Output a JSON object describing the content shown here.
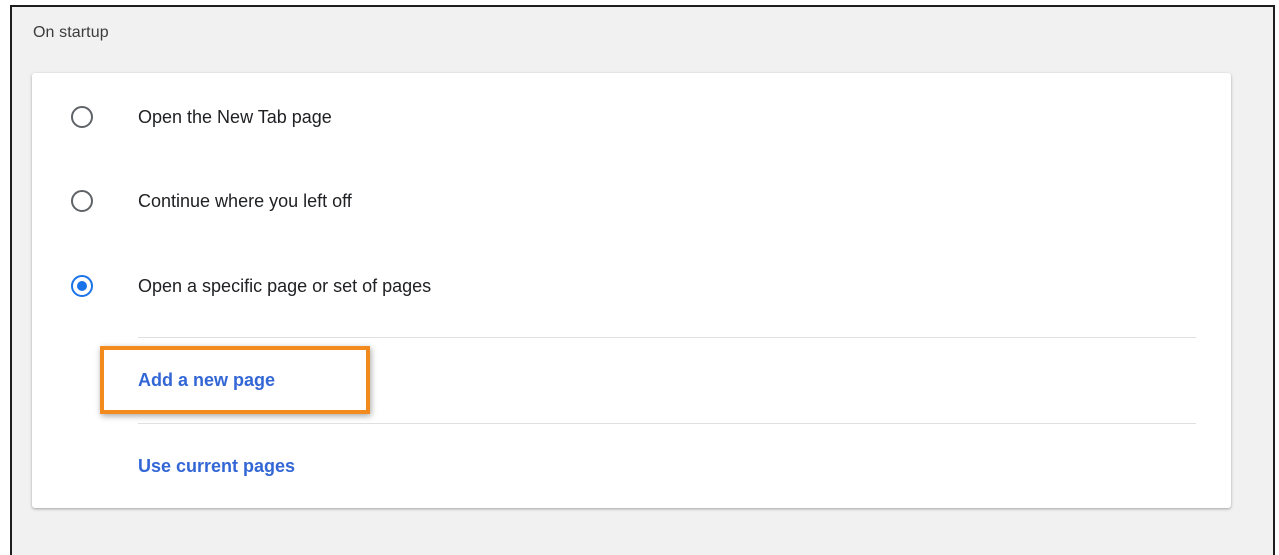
{
  "section": {
    "title": "On startup"
  },
  "startup_options": [
    {
      "label": "Open the New Tab page",
      "selected": false
    },
    {
      "label": "Continue where you left off",
      "selected": false
    },
    {
      "label": "Open a specific page or set of pages",
      "selected": true
    }
  ],
  "links": {
    "add_page": "Add a new page",
    "use_current": "Use current pages"
  },
  "colors": {
    "accent": "#1a73e8",
    "link": "#3367d6",
    "highlight": "#f28a1e",
    "background": "#f1f1f1"
  }
}
